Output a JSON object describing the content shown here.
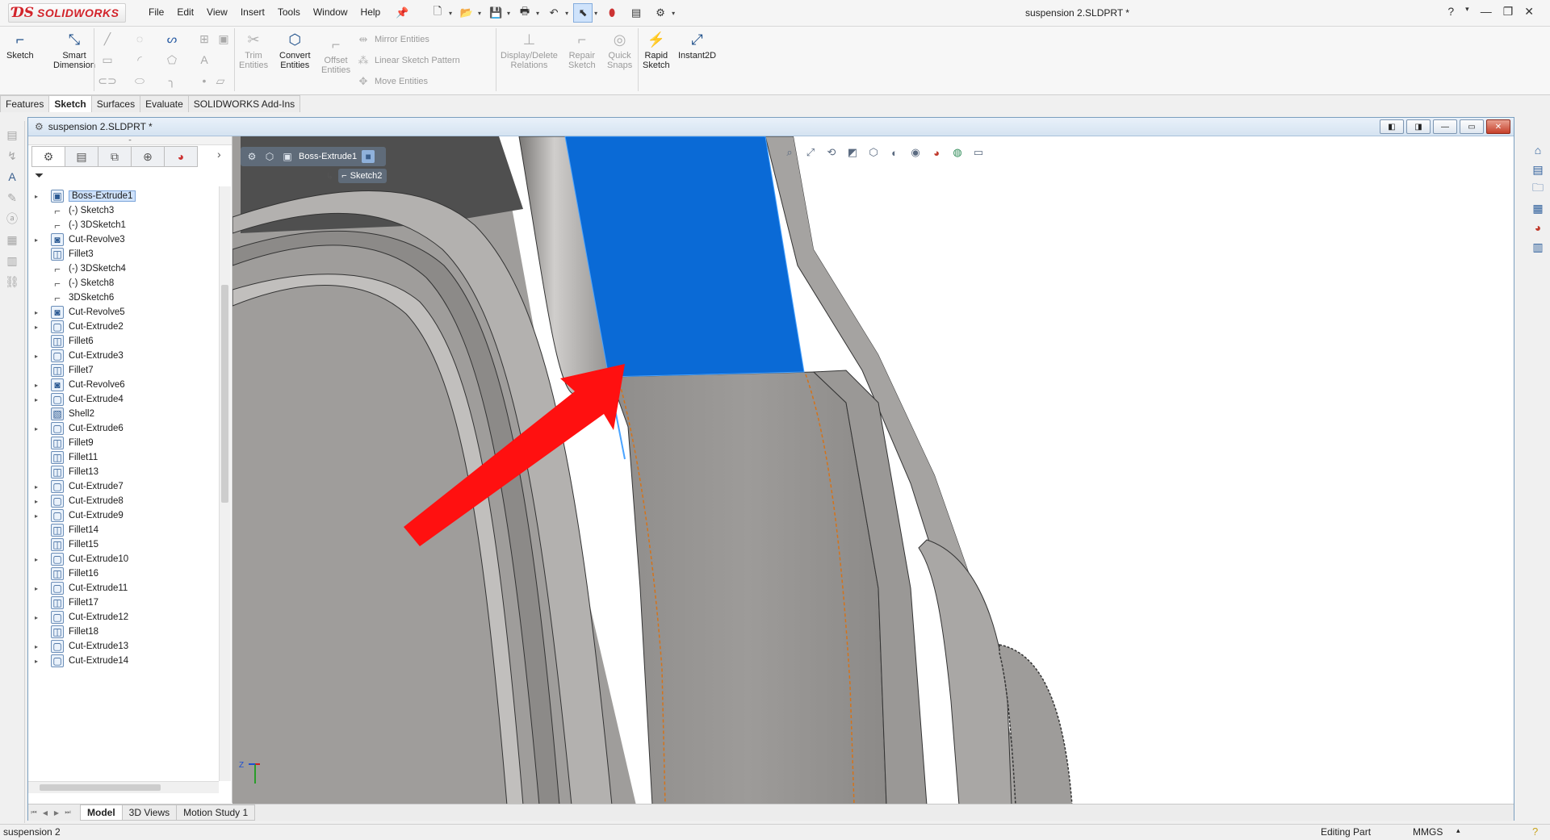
{
  "app": {
    "brand": "SOLIDWORKS",
    "document_title": "suspension 2.SLDPRT *"
  },
  "menu": [
    "File",
    "Edit",
    "View",
    "Insert",
    "Tools",
    "Window",
    "Help"
  ],
  "ribbon": {
    "sketch": "Sketch",
    "smart_dimension_1": "Smart",
    "smart_dimension_2": "Dimension",
    "trim_1": "Trim",
    "trim_2": "Entities",
    "convert_1": "Convert",
    "convert_2": "Entities",
    "offset_1": "Offset",
    "offset_2": "Entities",
    "mirror": "Mirror Entities",
    "linear_pattern": "Linear Sketch Pattern",
    "move": "Move Entities",
    "display_delete_1": "Display/Delete",
    "display_delete_2": "Relations",
    "repair_1": "Repair",
    "repair_2": "Sketch",
    "quick_snaps_1": "Quick",
    "quick_snaps_2": "Snaps",
    "rapid_sketch_1": "Rapid",
    "rapid_sketch_2": "Sketch",
    "instant2d": "Instant2D"
  },
  "command_tabs": [
    "Features",
    "Sketch",
    "Surfaces",
    "Evaluate",
    "SOLIDWORKS Add-Ins"
  ],
  "active_command_tab": "Sketch",
  "document_window": {
    "caption": "suspension 2.SLDPRT *"
  },
  "tree": [
    {
      "label": "Boss-Extrude1",
      "icon": "boss-extrude-icon",
      "expandable": true,
      "selected": true
    },
    {
      "label": "(-) Sketch3",
      "icon": "sketch-icon",
      "expandable": false
    },
    {
      "label": "(-) 3DSketch1",
      "icon": "3dsketch-icon",
      "expandable": false
    },
    {
      "label": "Cut-Revolve3",
      "icon": "cut-revolve-icon",
      "expandable": true
    },
    {
      "label": "Fillet3",
      "icon": "fillet-icon",
      "expandable": false
    },
    {
      "label": "(-) 3DSketch4",
      "icon": "3dsketch-icon",
      "expandable": false
    },
    {
      "label": "(-) Sketch8",
      "icon": "sketch-icon",
      "expandable": false
    },
    {
      "label": "3DSketch6",
      "icon": "3dsketch-icon",
      "expandable": false
    },
    {
      "label": "Cut-Revolve5",
      "icon": "cut-revolve-icon",
      "expandable": true
    },
    {
      "label": "Cut-Extrude2",
      "icon": "cut-extrude-icon",
      "expandable": true
    },
    {
      "label": "Fillet6",
      "icon": "fillet-icon",
      "expandable": false
    },
    {
      "label": "Cut-Extrude3",
      "icon": "cut-extrude-icon",
      "expandable": true
    },
    {
      "label": "Fillet7",
      "icon": "fillet-icon",
      "expandable": false
    },
    {
      "label": "Cut-Revolve6",
      "icon": "cut-revolve-icon",
      "expandable": true
    },
    {
      "label": "Cut-Extrude4",
      "icon": "cut-extrude-icon",
      "expandable": true
    },
    {
      "label": "Shell2",
      "icon": "shell-icon",
      "expandable": false
    },
    {
      "label": "Cut-Extrude6",
      "icon": "cut-extrude-icon",
      "expandable": true
    },
    {
      "label": "Fillet9",
      "icon": "fillet-icon",
      "expandable": false
    },
    {
      "label": "Fillet11",
      "icon": "fillet-icon",
      "expandable": false
    },
    {
      "label": "Fillet13",
      "icon": "fillet-icon",
      "expandable": false
    },
    {
      "label": "Cut-Extrude7",
      "icon": "cut-extrude-icon",
      "expandable": true
    },
    {
      "label": "Cut-Extrude8",
      "icon": "cut-extrude-icon",
      "expandable": true
    },
    {
      "label": "Cut-Extrude9",
      "icon": "cut-extrude-icon",
      "expandable": true
    },
    {
      "label": "Fillet14",
      "icon": "fillet-icon",
      "expandable": false
    },
    {
      "label": "Fillet15",
      "icon": "fillet-icon",
      "expandable": false
    },
    {
      "label": "Cut-Extrude10",
      "icon": "cut-extrude-icon",
      "expandable": true
    },
    {
      "label": "Fillet16",
      "icon": "fillet-icon",
      "expandable": false
    },
    {
      "label": "Cut-Extrude11",
      "icon": "cut-extrude-icon",
      "expandable": true
    },
    {
      "label": "Fillet17",
      "icon": "fillet-icon",
      "expandable": false
    },
    {
      "label": "Cut-Extrude12",
      "icon": "cut-extrude-icon",
      "expandable": true
    },
    {
      "label": "Fillet18",
      "icon": "fillet-icon",
      "expandable": false
    },
    {
      "label": "Cut-Extrude13",
      "icon": "cut-extrude-icon",
      "expandable": true
    },
    {
      "label": "Cut-Extrude14",
      "icon": "cut-extrude-icon",
      "expandable": true
    }
  ],
  "breadcrumb": {
    "feature": "Boss-Extrude1",
    "sketch": "Sketch2"
  },
  "triad": {
    "z": "Z"
  },
  "bottom_tabs": [
    "Model",
    "3D Views",
    "Motion Study 1"
  ],
  "active_bottom_tab": "Model",
  "status": {
    "left": "suspension 2",
    "editing": "Editing Part",
    "units": "MMGS"
  },
  "colors": {
    "selected_face": "#0a6ad6",
    "arrow": "#ff1010",
    "model_gray": "#9b9997",
    "edge_orange": "#d4731a"
  }
}
